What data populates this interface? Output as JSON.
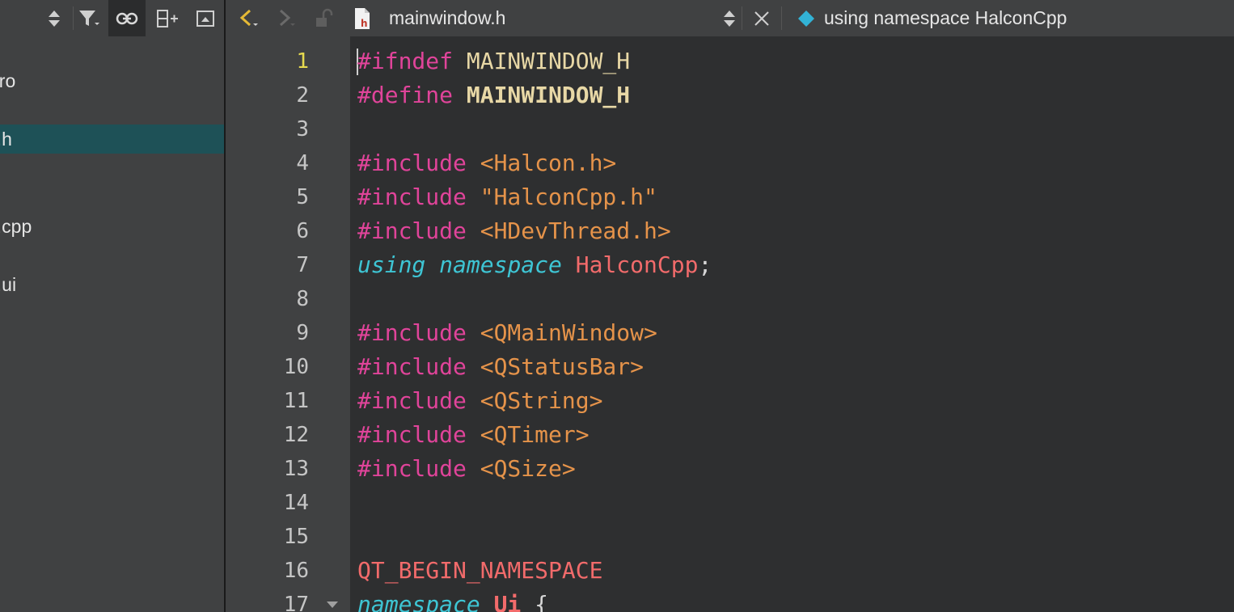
{
  "project_tree": {
    "items": [
      {
        "label": "pro",
        "selected": false
      },
      {
        "label": "v.h",
        "selected": true
      },
      {
        "label": "v.cpp",
        "selected": false
      },
      {
        "label": "v.ui",
        "selected": false
      }
    ]
  },
  "left_toolbar": {
    "buttons": [
      "sort-updown-icon",
      "filter-icon",
      "link-icon",
      "split-add-icon",
      "collapse-icon"
    ]
  },
  "editor_toolbar": {
    "file_name": "mainwindow.h",
    "symbol": "using namespace HalconCpp",
    "accent_color": "#e5b935",
    "symbol_icon_color": "#32b3d6",
    "file_icon_color": "#c0392b"
  },
  "editor": {
    "current_line": 1,
    "lines": [
      {
        "num": "1",
        "tokens": [
          {
            "t": "#ifndef ",
            "c": "pre"
          },
          {
            "t": "MAINWINDOW_H",
            "c": "macro"
          }
        ]
      },
      {
        "num": "2",
        "tokens": [
          {
            "t": "#define ",
            "c": "pre"
          },
          {
            "t": "MAINWINDOW_H",
            "c": "macro-b"
          }
        ]
      },
      {
        "num": "3",
        "tokens": []
      },
      {
        "num": "4",
        "tokens": [
          {
            "t": "#include ",
            "c": "pre"
          },
          {
            "t": "<Halcon.h>",
            "c": "sys"
          }
        ]
      },
      {
        "num": "5",
        "tokens": [
          {
            "t": "#include ",
            "c": "pre"
          },
          {
            "t": "\"HalconCpp.h\"",
            "c": "sys"
          }
        ]
      },
      {
        "num": "6",
        "tokens": [
          {
            "t": "#include ",
            "c": "pre"
          },
          {
            "t": "<HDevThread.h>",
            "c": "sys"
          }
        ]
      },
      {
        "num": "7",
        "tokens": [
          {
            "t": "using",
            "c": "kw"
          },
          {
            "t": " ",
            "c": "punct"
          },
          {
            "t": "namespace",
            "c": "kw"
          },
          {
            "t": " ",
            "c": "punct"
          },
          {
            "t": "HalconCpp",
            "c": "ns"
          },
          {
            "t": ";",
            "c": "punct"
          }
        ]
      },
      {
        "num": "8",
        "tokens": []
      },
      {
        "num": "9",
        "tokens": [
          {
            "t": "#include ",
            "c": "pre"
          },
          {
            "t": "<QMainWindow>",
            "c": "sys"
          }
        ]
      },
      {
        "num": "10",
        "tokens": [
          {
            "t": "#include ",
            "c": "pre"
          },
          {
            "t": "<QStatusBar>",
            "c": "sys"
          }
        ]
      },
      {
        "num": "11",
        "tokens": [
          {
            "t": "#include ",
            "c": "pre"
          },
          {
            "t": "<QString>",
            "c": "sys"
          }
        ]
      },
      {
        "num": "12",
        "tokens": [
          {
            "t": "#include ",
            "c": "pre"
          },
          {
            "t": "<QTimer>",
            "c": "sys"
          }
        ]
      },
      {
        "num": "13",
        "tokens": [
          {
            "t": "#include ",
            "c": "pre"
          },
          {
            "t": "<QSize>",
            "c": "sys"
          }
        ]
      },
      {
        "num": "14",
        "tokens": []
      },
      {
        "num": "15",
        "tokens": []
      },
      {
        "num": "16",
        "tokens": [
          {
            "t": "QT_BEGIN_NAMESPACE",
            "c": "ns"
          }
        ]
      },
      {
        "num": "17",
        "fold": true,
        "tokens": [
          {
            "t": "namespace",
            "c": "kw"
          },
          {
            "t": " ",
            "c": "punct"
          },
          {
            "t": "Ui",
            "c": "ns-b"
          },
          {
            "t": " {",
            "c": "punct"
          }
        ]
      }
    ]
  }
}
